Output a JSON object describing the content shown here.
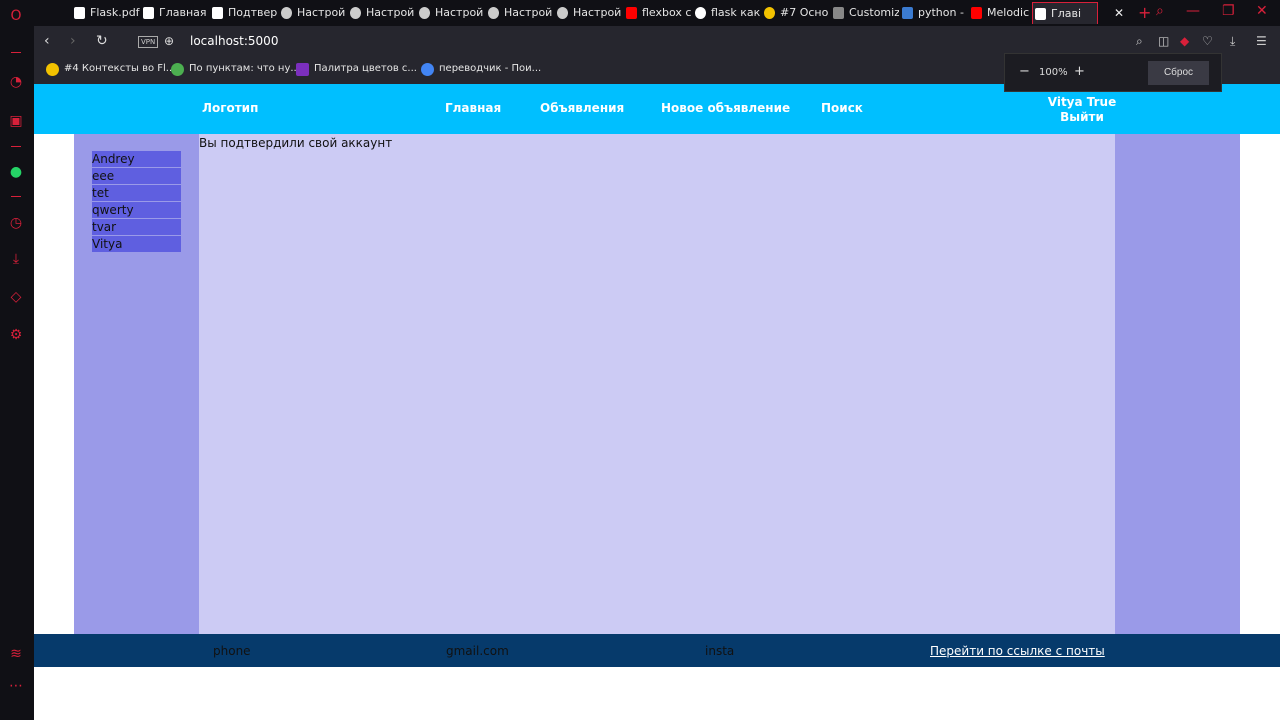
{
  "browser": {
    "tabs": [
      {
        "label": "Flask.pdf",
        "icon": "document-icon",
        "color": "#ffffff"
      },
      {
        "label": "Главная",
        "icon": "document-icon",
        "color": "#ffffff"
      },
      {
        "label": "Подтвер",
        "icon": "document-icon",
        "color": "#ffffff"
      },
      {
        "label": "Настрой",
        "icon": "gear-icon",
        "color": "#ffffff"
      },
      {
        "label": "Настрой",
        "icon": "gear-icon",
        "color": "#ffffff"
      },
      {
        "label": "Настрой",
        "icon": "gear-icon",
        "color": "#ffffff"
      },
      {
        "label": "Настрой",
        "icon": "gear-icon",
        "color": "#ffffff"
      },
      {
        "label": "Настрой",
        "icon": "gear-icon",
        "color": "#ffffff"
      },
      {
        "label": "flexbox c",
        "icon": "youtube-icon",
        "color": "#ff0000"
      },
      {
        "label": "flask как",
        "icon": "google-icon",
        "color": "#ffffff"
      },
      {
        "label": "#7 Осно",
        "icon": "python-icon",
        "color": "#f2c200"
      },
      {
        "label": "Customiz",
        "icon": "site-icon",
        "color": "#888888"
      },
      {
        "label": "python -",
        "icon": "site-icon",
        "color": "#3b7bd0"
      },
      {
        "label": "Melodic",
        "icon": "youtube-icon",
        "color": "#ff0000"
      },
      {
        "label": "Главі",
        "icon": "document-icon",
        "color": "#ffffff",
        "active": true
      }
    ],
    "url": "localhost:5000",
    "vpn_label": "VPN",
    "bookmarks": [
      {
        "label": "#4 Контексты во Fl...",
        "color": "#f2c200"
      },
      {
        "label": "По пунктам: что ну...",
        "color": "#4caf50"
      },
      {
        "label": "Палитра цветов с...",
        "color": "#7b2fbe"
      },
      {
        "label": "переводчик - Пои...",
        "color": "#4285f4"
      }
    ],
    "zoom": {
      "value": "100%",
      "minus": "−",
      "plus": "+",
      "reset_label": "Сброс"
    },
    "accent_color": "#d8203a"
  },
  "site": {
    "header": {
      "logo": "Логотип",
      "nav": [
        "Главная",
        "Объявления",
        "Новое объявление",
        "Поиск"
      ],
      "user_name": "Vitya True",
      "logout": "Выйти",
      "bg_color": "#00bfff"
    },
    "users": [
      "Andrey",
      "eee",
      "tet",
      "qwerty",
      "tvar",
      "Vitya"
    ],
    "message": "Вы подтвердили свой аккаунт",
    "footer": {
      "phone": "phone",
      "email": "gmail.com",
      "insta": "insta",
      "mail_link": "Перейти по ссылке с почты",
      "bg_color": "#063a6b"
    }
  }
}
